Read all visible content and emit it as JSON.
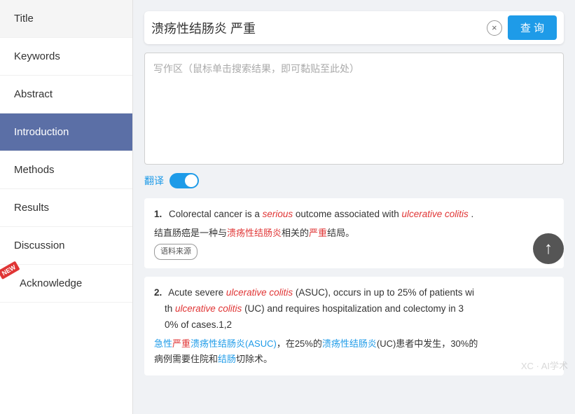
{
  "sidebar": {
    "items": [
      {
        "id": "title",
        "label": "Title",
        "active": false,
        "new": false
      },
      {
        "id": "keywords",
        "label": "Keywords",
        "active": false,
        "new": false
      },
      {
        "id": "abstract",
        "label": "Abstract",
        "active": false,
        "new": false
      },
      {
        "id": "introduction",
        "label": "Introduction",
        "active": true,
        "new": false
      },
      {
        "id": "methods",
        "label": "Methods",
        "active": false,
        "new": false
      },
      {
        "id": "results",
        "label": "Results",
        "active": false,
        "new": false
      },
      {
        "id": "discussion",
        "label": "Discussion",
        "active": false,
        "new": false
      },
      {
        "id": "acknowledge",
        "label": "Acknowledge",
        "active": false,
        "new": true
      }
    ]
  },
  "search": {
    "value": "溃疡性结肠炎 严重",
    "clear_label": "×",
    "query_label": "查 询"
  },
  "writing": {
    "placeholder": "写作区（鼠标单击搜索结果，即可黏贴至此处）"
  },
  "translate": {
    "label": "翻译"
  },
  "results": [
    {
      "number": "1.",
      "text_before": "Colorectal cancer is a ",
      "serious": "serious",
      "text_middle": " outcome associated with ",
      "ulcerative_colitis": "ulcerative colitis",
      "text_after": ".",
      "translation": "结直肠癌是一种与溃疡性结肠炎相关的严重结局。",
      "source": "语料来源"
    },
    {
      "number": "2.",
      "line1": "Acute severe ",
      "uc1": "ulcerative colitis",
      "line1b": " (ASUC), occurs in up to 25% of patients wi",
      "line2": "th ",
      "uc2": "ulcerative colitis",
      "line2b": " (UC) and requires hospitalization and colectomy in 3",
      "line3": "0% of cases.1,2",
      "translation": "急性严重溃疡性结肠炎(ASUC)，在25%的溃疡性结肠炎(UC)患者中发生，30%的病例需要住院和结肠切除术。"
    }
  ],
  "new_badge": "NEW",
  "watermark": "XC · AI学术"
}
